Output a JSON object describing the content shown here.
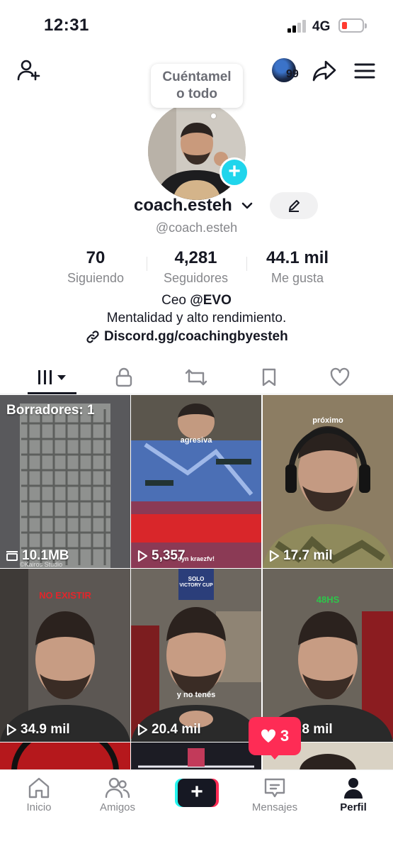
{
  "status_bar": {
    "time": "12:31",
    "network": "4G",
    "battery_level": 0.15,
    "battery_color": "#ff3b30"
  },
  "header": {
    "add_friend_icon": "person-add-icon",
    "avatar_badge_count": "99",
    "share_icon": "share-arrow-icon",
    "menu_icon": "hamburger-menu-icon"
  },
  "profile": {
    "bubble_line1": "Cuéntamel",
    "bubble_line2": "o todo",
    "username": "coach.esteh",
    "handle": "@coach.esteh",
    "stats": [
      {
        "value": "70",
        "label": "Siguiendo"
      },
      {
        "value": "4,281",
        "label": "Seguidores"
      },
      {
        "value": "44.1 mil",
        "label": "Me gusta"
      }
    ],
    "bio_prefix": "Ceo ",
    "bio_mention": "@EVO",
    "bio_line2": "Mentalidad y alto rendimiento.",
    "bio_link": "Discord.gg/coachingbyesteh"
  },
  "tabs": [
    {
      "icon": "grid-icon",
      "active": true
    },
    {
      "icon": "lock-icon",
      "active": false
    },
    {
      "icon": "repost-icon",
      "active": false
    },
    {
      "icon": "bookmark-icon",
      "active": false
    },
    {
      "icon": "heart-icon",
      "active": false
    }
  ],
  "videos": [
    {
      "draft_label": "Borradores: 1",
      "stat": "10.1MB",
      "watermark": "©Kairos Studio"
    },
    {
      "stat": "5,357",
      "caption": "agresiva",
      "overlay": "cyn kraezfv!"
    },
    {
      "stat": "17.7 mil",
      "caption": "próximo"
    },
    {
      "stat": "34.9 mil",
      "caption": "NO EXISTIR"
    },
    {
      "stat": "20.4 mil",
      "caption": "y no tenés",
      "badge_line1": "SOLO",
      "badge_line2": "VICTORY CUP"
    },
    {
      "stat": "18.8 mil",
      "caption": "48HS"
    }
  ],
  "like_popup": {
    "count": "3",
    "color": "#fe2c55"
  },
  "bottom_nav": [
    {
      "label": "Inicio",
      "icon": "home-icon"
    },
    {
      "label": "Amigos",
      "icon": "friends-icon"
    },
    {
      "label": "",
      "icon": "create-plus-icon"
    },
    {
      "label": "Mensajes",
      "icon": "inbox-icon"
    },
    {
      "label": "Perfil",
      "icon": "profile-icon"
    }
  ]
}
